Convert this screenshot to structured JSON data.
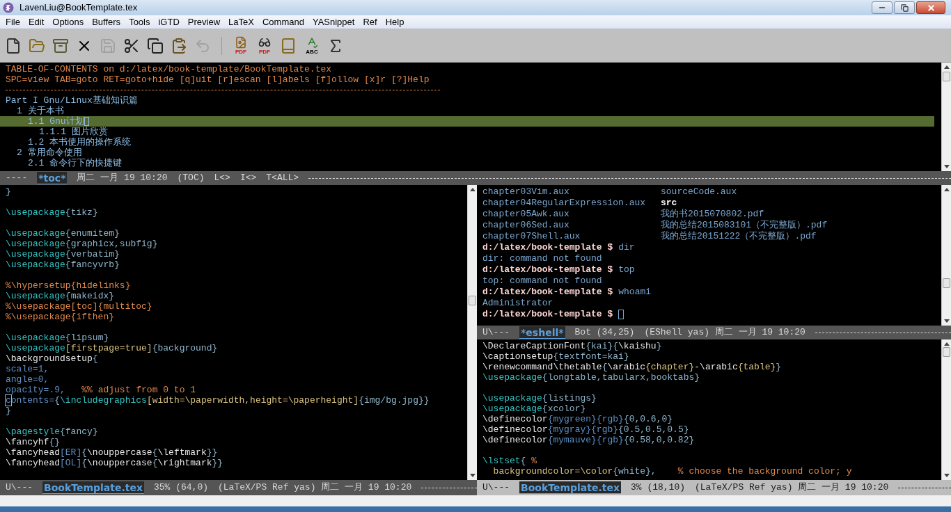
{
  "window": {
    "title": "LavenLiu@BookTemplate.tex"
  },
  "menu": [
    "File",
    "Edit",
    "Options",
    "Buffers",
    "Tools",
    "iGTD",
    "Preview",
    "LaTeX",
    "Command",
    "YASnippet",
    "Ref",
    "Help"
  ],
  "toolbar": [
    {
      "kind": "new",
      "disabled": false
    },
    {
      "kind": "open",
      "disabled": false
    },
    {
      "kind": "cabinet",
      "disabled": false
    },
    {
      "kind": "close",
      "disabled": false
    },
    {
      "kind": "save",
      "disabled": true
    },
    {
      "kind": "cut",
      "disabled": false
    },
    {
      "kind": "copy",
      "disabled": false
    },
    {
      "kind": "paste",
      "disabled": false
    },
    {
      "kind": "undo",
      "disabled": true
    },
    {
      "kind": "separator"
    },
    {
      "kind": "pdf-lion",
      "disabled": false,
      "label": "PDF"
    },
    {
      "kind": "pdf-glasses",
      "disabled": false,
      "label": "PDF"
    },
    {
      "kind": "bib",
      "disabled": false
    },
    {
      "kind": "spell",
      "disabled": false,
      "label": "ABC"
    },
    {
      "kind": "tex",
      "disabled": false
    }
  ],
  "toc": {
    "header": [
      "TABLE-OF-CONTENTS on d:/latex/book-template/BookTemplate.tex",
      "SPC=view TAB=goto RET=goto+hide [q]uit [r]escan [l]abels [f]ollow [x]r [?]Help"
    ],
    "entries": [
      {
        "text": "Part I Gnu/Linux基础知识篇",
        "selected": false,
        "children": [
          {
            "text": "1 关于本书",
            "selected": false,
            "children": [
              {
                "text": "1.1 Gnu计划",
                "selected": true,
                "cursor": true,
                "children": [
                  {
                    "text": "1.1.1 图片欣赏",
                    "selected": false
                  }
                ]
              },
              {
                "text": "1.2 本书使用的操作系统",
                "selected": false
              }
            ]
          },
          {
            "text": "2 常用命令使用",
            "selected": false,
            "children": [
              {
                "text": "2.1 命令行下的快捷键",
                "selected": false
              }
            ]
          }
        ]
      }
    ]
  },
  "toc_mode_line": {
    "active": false,
    "prefix": "----",
    "buffer": "*toc*",
    "fields": [
      "周二 一月 19 10:20",
      "(TOC)",
      "L<>",
      "I<>",
      "T<ALL>"
    ]
  },
  "left_editor": {
    "lines": [
      {
        "segments": [
          {
            "kind": "arg",
            "text": "}"
          }
        ]
      },
      {
        "kind": "blank"
      },
      {
        "segments": [
          {
            "kind": "cmd",
            "text": "\\usepackage"
          },
          {
            "kind": "arg",
            "text": "{tikz}"
          }
        ]
      },
      {
        "kind": "blank"
      },
      {
        "segments": [
          {
            "kind": "cmd",
            "text": "\\usepackage"
          },
          {
            "kind": "arg",
            "text": "{enumitem}"
          }
        ]
      },
      {
        "segments": [
          {
            "kind": "cmd",
            "text": "\\usepackage"
          },
          {
            "kind": "arg",
            "text": "{graphicx,subfig}"
          }
        ]
      },
      {
        "segments": [
          {
            "kind": "cmd",
            "text": "\\usepackage"
          },
          {
            "kind": "arg",
            "text": "{verbatim}"
          }
        ]
      },
      {
        "segments": [
          {
            "kind": "cmd",
            "text": "\\usepackage"
          },
          {
            "kind": "arg",
            "text": "{fancyvrb}"
          }
        ]
      },
      {
        "kind": "blank"
      },
      {
        "segments": [
          {
            "kind": "comment",
            "text": "%\\hypersetup{hidelinks}"
          }
        ]
      },
      {
        "segments": [
          {
            "kind": "cmd",
            "text": "\\usepackage"
          },
          {
            "kind": "arg",
            "text": "{makeidx}"
          }
        ]
      },
      {
        "segments": [
          {
            "kind": "comment",
            "text": "%\\usepackage[toc]{multitoc}"
          }
        ]
      },
      {
        "segments": [
          {
            "kind": "comment",
            "text": "%\\usepackage{ifthen}"
          }
        ]
      },
      {
        "kind": "blank"
      },
      {
        "segments": [
          {
            "kind": "cmd",
            "text": "\\usepackage"
          },
          {
            "kind": "arg",
            "text": "{lipsum}"
          }
        ]
      },
      {
        "segments": [
          {
            "kind": "cmd",
            "text": "\\usepackage"
          },
          {
            "kind": "opt",
            "text": "[firstpage=true]"
          },
          {
            "kind": "arg",
            "text": "{background}"
          }
        ]
      },
      {
        "segments": [
          {
            "kind": "plain",
            "text": "\\backgroundsetup"
          },
          {
            "kind": "arg",
            "text": "{"
          }
        ]
      },
      {
        "segments": [
          {
            "kind": "val",
            "text": "scale=1,"
          }
        ]
      },
      {
        "segments": [
          {
            "kind": "val",
            "text": "angle=0,"
          }
        ]
      },
      {
        "segments": [
          {
            "kind": "val",
            "text": "opacity=.9,"
          },
          {
            "kind": "comment",
            "text": "   %% adjust from 0 to 1"
          }
        ]
      },
      {
        "cursor": true,
        "segments": [
          {
            "kind": "val",
            "text": "contents="
          },
          {
            "kind": "arg",
            "text": "{"
          },
          {
            "kind": "cmd",
            "text": "\\includegraphics"
          },
          {
            "kind": "opt",
            "text": "[width=\\paperwidth,height=\\paperheight]"
          },
          {
            "kind": "arg",
            "text": "{img/bg.jpg}}"
          }
        ]
      },
      {
        "segments": [
          {
            "kind": "arg",
            "text": "}"
          }
        ]
      },
      {
        "kind": "blank"
      },
      {
        "segments": [
          {
            "kind": "cmd",
            "text": "\\pagestyle"
          },
          {
            "kind": "arg",
            "text": "{fancy}"
          }
        ]
      },
      {
        "segments": [
          {
            "kind": "plain",
            "text": "\\fancyhf"
          },
          {
            "kind": "arg",
            "text": "{}"
          }
        ]
      },
      {
        "segments": [
          {
            "kind": "plain",
            "text": "\\fancyhead"
          },
          {
            "kind": "val",
            "text": "[ER]"
          },
          {
            "kind": "arg",
            "text": "{"
          },
          {
            "kind": "plain",
            "text": "\\nouppercase"
          },
          {
            "kind": "arg",
            "text": "{"
          },
          {
            "kind": "plain",
            "text": "\\leftmark"
          },
          {
            "kind": "arg",
            "text": "}}"
          }
        ]
      },
      {
        "segments": [
          {
            "kind": "plain",
            "text": "\\fancyhead"
          },
          {
            "kind": "val",
            "text": "[OL]"
          },
          {
            "kind": "arg",
            "text": "{"
          },
          {
            "kind": "plain",
            "text": "\\nouppercase"
          },
          {
            "kind": "arg",
            "text": "{"
          },
          {
            "kind": "plain",
            "text": "\\rightmark"
          },
          {
            "kind": "arg",
            "text": "}}"
          }
        ]
      }
    ]
  },
  "left_mode_line": {
    "active": false,
    "prefix": "U\\---",
    "buffer": "BookTemplate.tex",
    "fields": [
      "35% (64,0)",
      "(LaTeX/PS Ref yas) 周二 一月 19 10:20"
    ]
  },
  "eshell": {
    "rows": [
      {
        "kind": "listing",
        "cells": [
          {
            "kind": "file",
            "text": "chapter03Vim.aux"
          },
          {
            "kind": "file",
            "text": "sourceCode.aux"
          }
        ]
      },
      {
        "kind": "listing",
        "cells": [
          {
            "kind": "file",
            "text": "chapter04RegularExpression.aux"
          },
          {
            "kind": "dir",
            "text": "src"
          }
        ]
      },
      {
        "kind": "listing",
        "cells": [
          {
            "kind": "file",
            "text": "chapter05Awk.aux"
          },
          {
            "kind": "file",
            "text": "我的书2015070802.pdf"
          }
        ]
      },
      {
        "kind": "listing",
        "cells": [
          {
            "kind": "file",
            "text": "chapter06Sed.aux"
          },
          {
            "kind": "file",
            "text": "我的总结2015083101（不完整版）.pdf"
          }
        ]
      },
      {
        "kind": "listing",
        "cells": [
          {
            "kind": "file",
            "text": "chapter07Shell.aux"
          },
          {
            "kind": "file",
            "text": "我的总结20151222（不完整版）.pdf"
          }
        ]
      },
      {
        "kind": "prompt",
        "prompt": "d:/latex/book-template $",
        "command": "dir",
        "cursor": false
      },
      {
        "kind": "output",
        "text": "dir: command not found"
      },
      {
        "kind": "prompt",
        "prompt": "d:/latex/book-template $",
        "command": "top",
        "cursor": false
      },
      {
        "kind": "output",
        "text": "top: command not found"
      },
      {
        "kind": "prompt",
        "prompt": "d:/latex/book-template $",
        "command": "whoami",
        "cursor": false
      },
      {
        "kind": "output",
        "text": "Administrator"
      },
      {
        "kind": "prompt",
        "prompt": "d:/latex/book-template $",
        "command": "",
        "cursor": true
      }
    ]
  },
  "eshell_mode_line": {
    "active": false,
    "prefix": "U\\---",
    "buffer": "*eshell*",
    "fields": [
      "Bot (34,25)",
      "(EShell yas) 周二 一月 19 10:20"
    ]
  },
  "right_editor": {
    "lines": [
      {
        "segments": [
          {
            "kind": "plain",
            "text": "\\DeclareCaptionFont"
          },
          {
            "kind": "arg",
            "text": "{kai}"
          },
          {
            "kind": "arg",
            "text": "{"
          },
          {
            "kind": "plain",
            "text": "\\kaishu"
          },
          {
            "kind": "arg",
            "text": "}"
          }
        ]
      },
      {
        "segments": [
          {
            "kind": "plain",
            "text": "\\captionsetup"
          },
          {
            "kind": "arg",
            "text": "{textfont=kai}"
          }
        ]
      },
      {
        "segments": [
          {
            "kind": "plain",
            "text": "\\renewcommand\\thetable"
          },
          {
            "kind": "arg",
            "text": "{"
          },
          {
            "kind": "plain",
            "text": "\\arabic"
          },
          {
            "kind": "opt",
            "text": "{chapter}"
          },
          {
            "kind": "plain",
            "text": "-\\arabic"
          },
          {
            "kind": "opt",
            "text": "{table}"
          },
          {
            "kind": "arg",
            "text": "}"
          }
        ]
      },
      {
        "segments": [
          {
            "kind": "cmd",
            "text": "\\usepackage"
          },
          {
            "kind": "arg",
            "text": "{longtable,tabularx,booktabs}"
          }
        ]
      },
      {
        "kind": "blank"
      },
      {
        "segments": [
          {
            "kind": "cmd",
            "text": "\\usepackage"
          },
          {
            "kind": "arg",
            "text": "{listings}"
          }
        ]
      },
      {
        "segments": [
          {
            "kind": "cmd",
            "text": "\\usepackage"
          },
          {
            "kind": "arg",
            "text": "{xcolor}"
          }
        ]
      },
      {
        "segments": [
          {
            "kind": "plain",
            "text": "\\definecolor"
          },
          {
            "kind": "val",
            "text": "{mygreen}"
          },
          {
            "kind": "val",
            "text": "{rgb}"
          },
          {
            "kind": "arg",
            "text": "{0,0.6,0}"
          }
        ]
      },
      {
        "segments": [
          {
            "kind": "plain",
            "text": "\\definecolor"
          },
          {
            "kind": "val",
            "text": "{mygray}"
          },
          {
            "kind": "val",
            "text": "{rgb}"
          },
          {
            "kind": "arg",
            "text": "{0.5,0.5,0.5}"
          }
        ]
      },
      {
        "segments": [
          {
            "kind": "plain",
            "text": "\\definecolor"
          },
          {
            "kind": "val",
            "text": "{mymauve}"
          },
          {
            "kind": "val",
            "text": "{rgb}"
          },
          {
            "kind": "arg",
            "text": "{0.58,0,0.82}"
          }
        ]
      },
      {
        "kind": "blank"
      },
      {
        "segments": [
          {
            "kind": "cmd",
            "text": "\\lstset"
          },
          {
            "kind": "arg",
            "text": "{ "
          },
          {
            "kind": "comment",
            "text": "%"
          }
        ]
      },
      {
        "segments": [
          {
            "kind": "opt",
            "text": "  backgroundcolor=\\color"
          },
          {
            "kind": "arg",
            "text": "{white},"
          },
          {
            "kind": "comment",
            "text": "    % choose the background color; y"
          }
        ]
      }
    ]
  },
  "right_mode_line": {
    "active": true,
    "prefix": "U\\---",
    "buffer": "BookTemplate.tex",
    "fields": [
      "3% (18,10)",
      "(LaTeX/PS Ref yas) 周二 一月 19 10:20"
    ]
  }
}
